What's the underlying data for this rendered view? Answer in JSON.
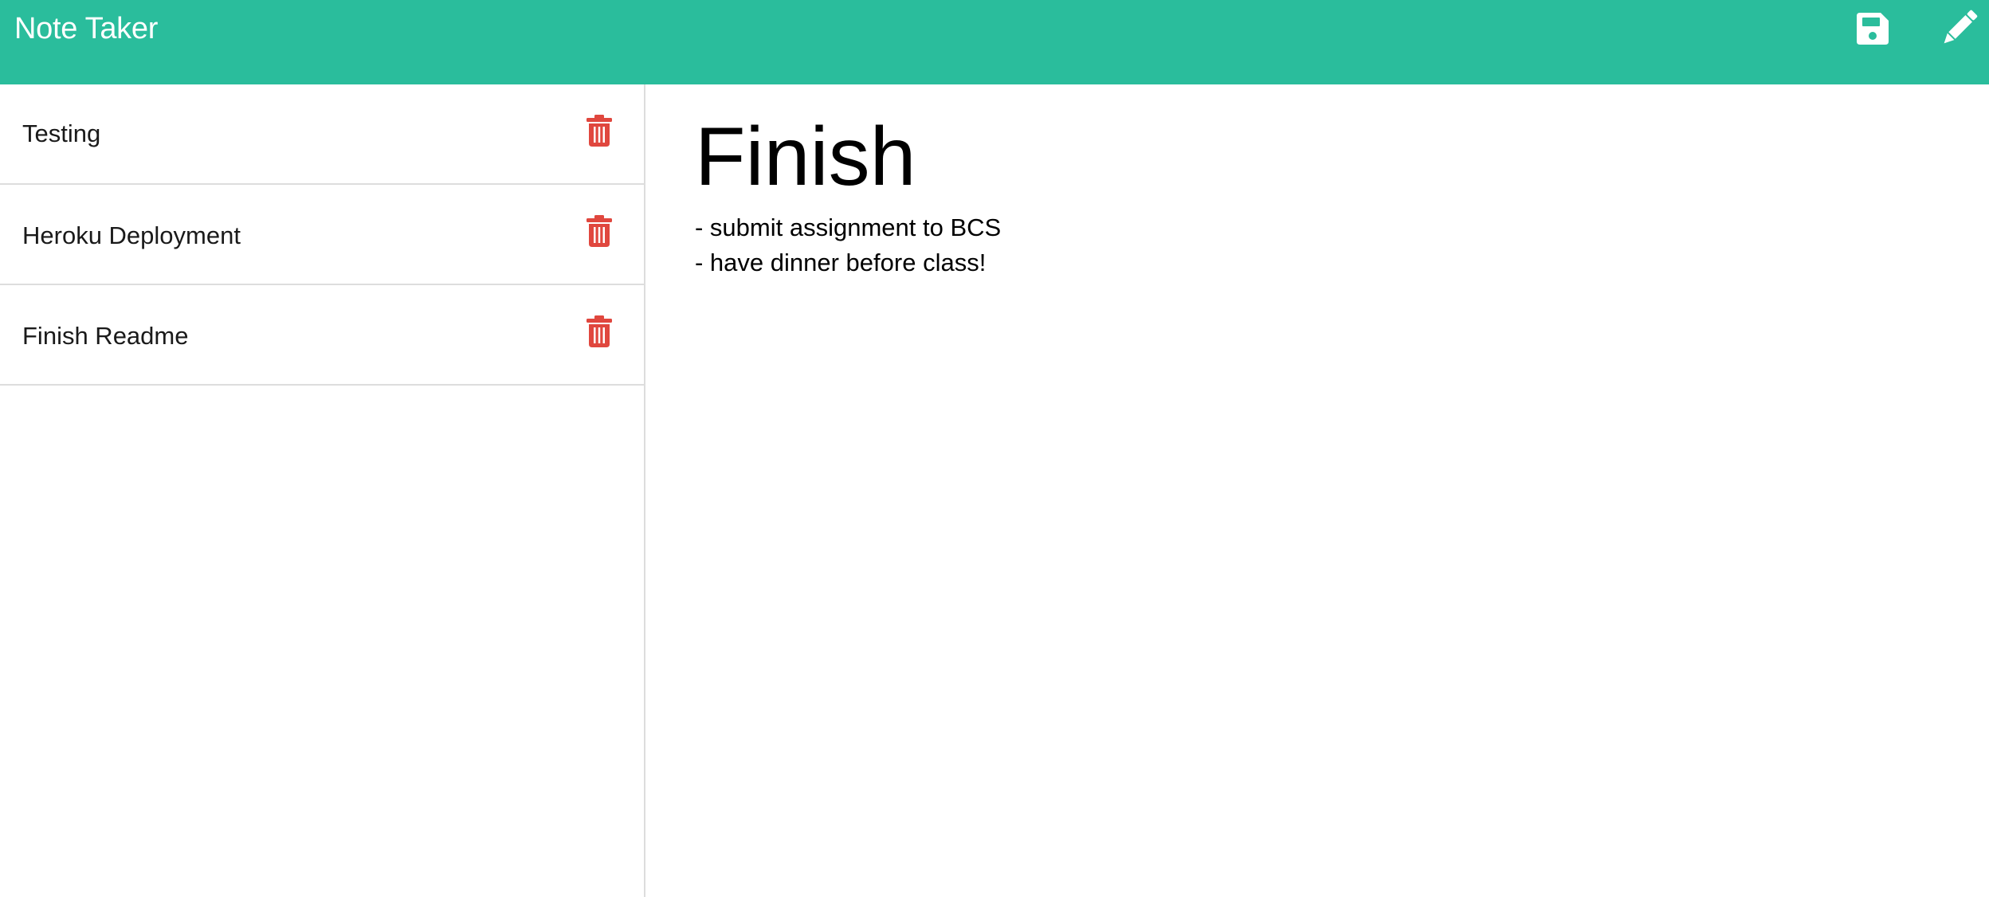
{
  "app": {
    "title": "Note Taker"
  },
  "navbar": {
    "save_icon": "save-icon",
    "new_note_icon": "pencil-icon",
    "background_color": "#2abd9c",
    "icon_color": "#ffffff"
  },
  "notes": [
    {
      "title": "Testing",
      "delete_icon": "trash-icon"
    },
    {
      "title": "Heroku Deployment",
      "delete_icon": "trash-icon"
    },
    {
      "title": "Finish Readme",
      "delete_icon": "trash-icon"
    }
  ],
  "active_note": {
    "title": "Finish",
    "text_lines": [
      "- submit assignment to BCS",
      "- have dinner before class!"
    ]
  },
  "colors": {
    "accent": "#2abd9c",
    "delete": "#e0473e",
    "divider": "#dddddd"
  }
}
